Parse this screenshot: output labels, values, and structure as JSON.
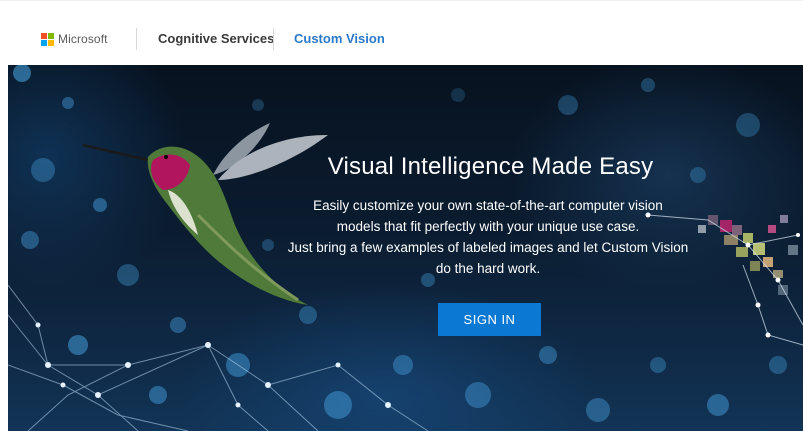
{
  "nav": {
    "brand": "Microsoft",
    "cognitive_services": "Cognitive Services",
    "custom_vision": "Custom Vision",
    "logo_colors": [
      "#f25022",
      "#7fba00",
      "#00a4ef",
      "#ffb900"
    ],
    "accent_color": "#2b79c9"
  },
  "hero": {
    "title": "Visual Intelligence Made Easy",
    "desc_line1": "Easily customize your own state-of-the-art computer vision",
    "desc_line2": "models that fit perfectly with your unique use case.",
    "desc_line3": "Just bring a few examples of labeled images and let Custom Vision",
    "desc_line4": "do the hard work.",
    "sign_in_label": "SIGN IN",
    "button_color": "#0b78d4",
    "image": "hummingbird-network-illustration"
  }
}
